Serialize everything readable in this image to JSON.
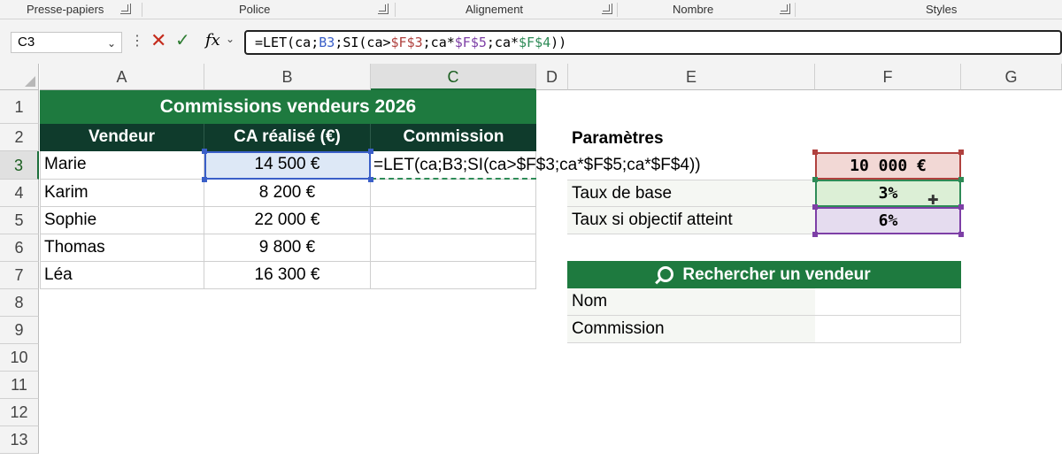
{
  "ribbon": {
    "groups": [
      "Presse-papiers",
      "Police",
      "Alignement",
      "Nombre",
      "Styles"
    ]
  },
  "formula_bar": {
    "name_box": "C3",
    "formula_parts": [
      {
        "t": "=LET(ca;",
        "c": "plain"
      },
      {
        "t": "B3",
        "c": "blue"
      },
      {
        "t": ";SI(ca>",
        "c": "plain"
      },
      {
        "t": "$F$3",
        "c": "red"
      },
      {
        "t": ";ca*",
        "c": "plain"
      },
      {
        "t": "$F$5",
        "c": "purple"
      },
      {
        "t": ";ca*",
        "c": "plain"
      },
      {
        "t": "$F$4",
        "c": "green"
      },
      {
        "t": "))",
        "c": "plain"
      }
    ]
  },
  "columns": [
    "A",
    "B",
    "C",
    "D",
    "E",
    "F",
    "G"
  ],
  "rows": [
    "1",
    "2",
    "3",
    "4",
    "5",
    "6",
    "7",
    "8",
    "9",
    "10",
    "11",
    "12",
    "13"
  ],
  "table": {
    "title": "Commissions vendeurs 2026",
    "headers": [
      "Vendeur",
      "CA réalisé (€)",
      "Commission"
    ],
    "rows": [
      {
        "vendeur": "Marie",
        "ca": "14 500 €"
      },
      {
        "vendeur": "Karim",
        "ca": "8 200 €"
      },
      {
        "vendeur": "Sophie",
        "ca": "22 000 €"
      },
      {
        "vendeur": "Thomas",
        "ca": "9 800 €"
      },
      {
        "vendeur": "Léa",
        "ca": "16 300 €"
      }
    ],
    "edit_text": "=LET(ca;B3;SI(ca>$F$3;ca*$F$5;ca*$F$4))"
  },
  "params": {
    "title": "Paramètres",
    "threshold_value": "10 000 €",
    "base_rate_label": "Taux de base",
    "base_rate_value": "3%",
    "target_rate_label": "Taux si objectif atteint",
    "target_rate_value": "6%"
  },
  "search": {
    "title": "Rechercher un vendeur",
    "name_label": "Nom",
    "commission_label": "Commission"
  },
  "colors": {
    "title_green": "#1e7a3f",
    "header_dark": "#0f3b2c",
    "ref_blue": "#3a5fc8",
    "ref_red": "#b0413e",
    "ref_green": "#2e8b57",
    "ref_purple": "#7d3fa6"
  }
}
